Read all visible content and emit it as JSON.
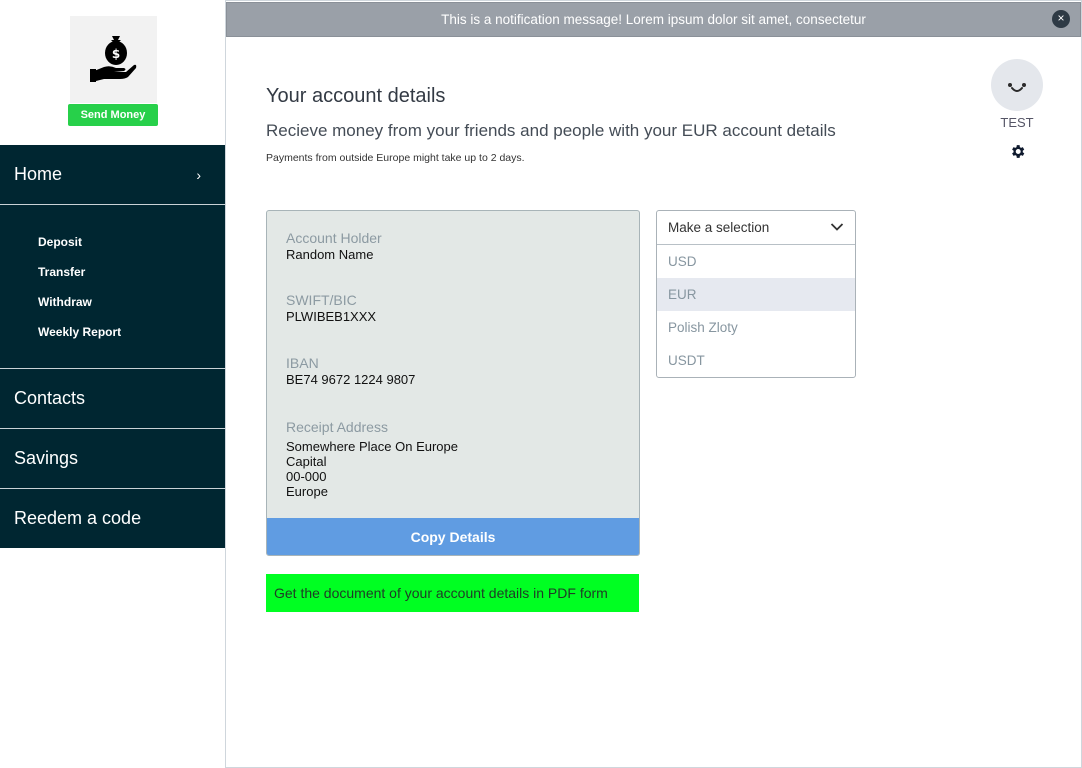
{
  "notification": {
    "message": "This is a notification message! Lorem ipsum dolor sit amet, consectetur",
    "close_icon": "close-icon"
  },
  "sidebar": {
    "logo_icon": "money-bag-hand-icon",
    "send_money_label": "Send Money",
    "home": {
      "label": "Home",
      "chevron": "›"
    },
    "sub_items": [
      {
        "label": "Deposit"
      },
      {
        "label": "Transfer"
      },
      {
        "label": "Withdraw"
      },
      {
        "label": "Weekly Report"
      }
    ],
    "nav_items": [
      {
        "label": "Contacts"
      },
      {
        "label": "Savings"
      },
      {
        "label": "Reedem a code"
      }
    ],
    "colors": {
      "nav_bg": "#002631",
      "send_money_bg": "#27d04a"
    }
  },
  "profile": {
    "name": "TEST",
    "avatar_icon": "smiley-face-icon",
    "settings_icon": "gear-icon"
  },
  "main": {
    "title": "Your account details",
    "subtitle": "Recieve money from your friends and people with your EUR account details",
    "note": "Payments from outside Europe might take up to 2 days."
  },
  "account": {
    "holder_label": "Account Holder",
    "holder_value": "Random Name",
    "swift_label": "SWIFT/BIC",
    "swift_value": "PLWIBEB1XXX",
    "iban_label": "IBAN",
    "iban_value": "BE74 9672 1224 9807",
    "address_label": "Receipt Address",
    "address_lines": [
      "Somewhere Place On Europe",
      "Capital",
      "00-000",
      "Europe"
    ],
    "copy_button": "Copy Details",
    "pdf_button": "Get the document of your account details in PDF form"
  },
  "currency_select": {
    "placeholder": "Make a selection",
    "chevron_icon": "chevron-down-icon",
    "options": [
      "USD",
      "EUR",
      "Polish Zloty",
      "USDT"
    ],
    "highlighted": "EUR"
  }
}
